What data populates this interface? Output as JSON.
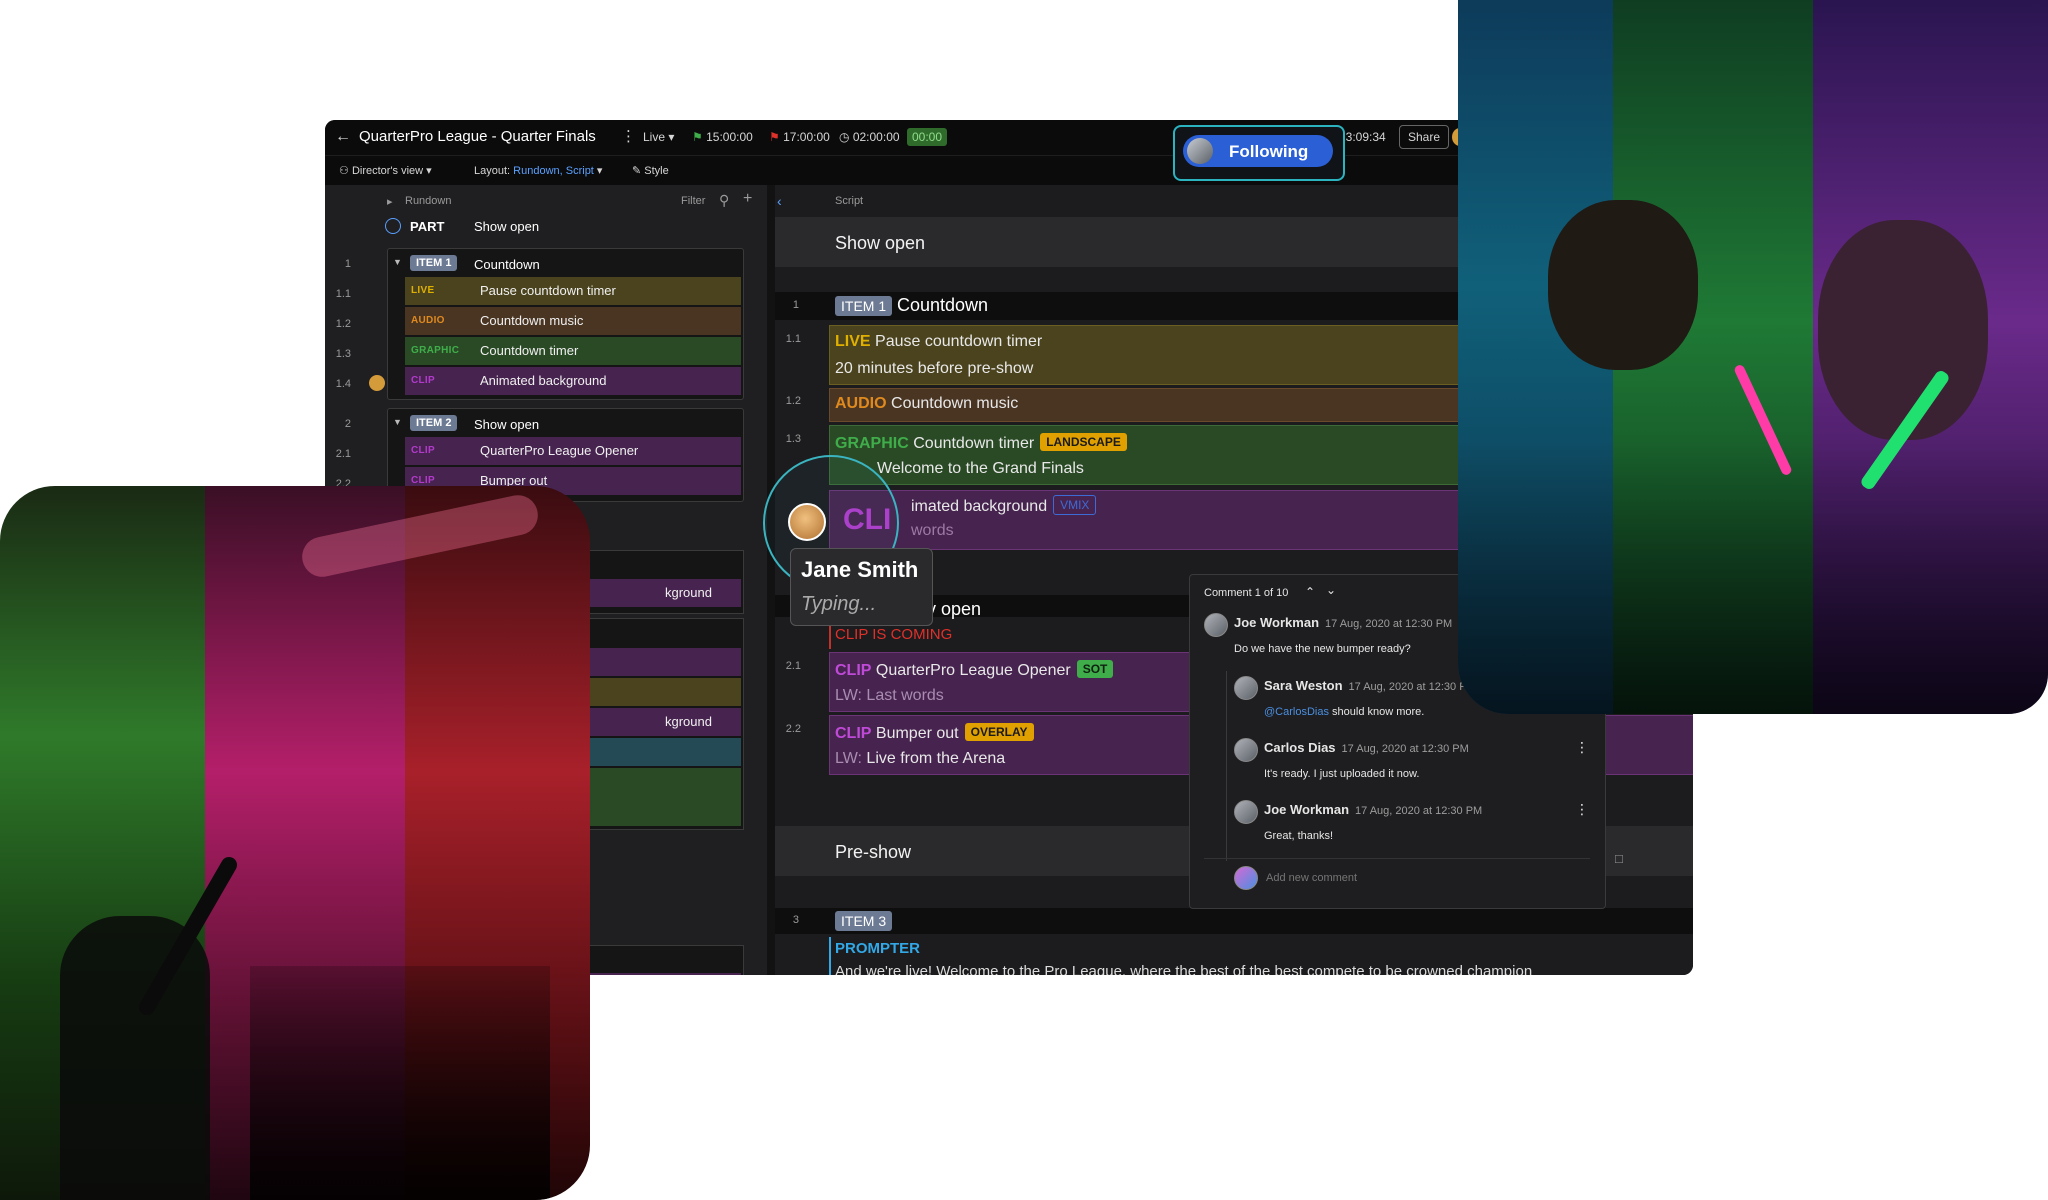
{
  "topbar": {
    "title": "QuarterPro League - Quarter Finals",
    "live_label": "Live",
    "start_time": "15:00:00",
    "end_time": "17:00:00",
    "duration": "02:00:00",
    "timer": "00:00",
    "clock": "13:09:34",
    "share_label": "Share",
    "following_label": "Following"
  },
  "toolbar": {
    "view_label": "Director's view",
    "layout_label": "Layout:",
    "layout_value": "Rundown, Script",
    "style_label": "Style"
  },
  "rundown": {
    "header": "Rundown",
    "filter_label": "Filter",
    "part_label": "PART",
    "part_title": "Show open",
    "items": [
      {
        "num": "1",
        "badge": "ITEM 1",
        "title": "Countdown"
      },
      {
        "num": "2",
        "badge": "ITEM 2",
        "title": "Show open"
      }
    ],
    "rows": [
      {
        "num": "1.1",
        "tag": "LIVE",
        "text": "Pause countdown timer"
      },
      {
        "num": "1.2",
        "tag": "AUDIO",
        "text": "Countdown music"
      },
      {
        "num": "1.3",
        "tag": "GRAPHIC",
        "text": "Countdown timer"
      },
      {
        "num": "1.4",
        "tag": "CLIP",
        "text": "Animated background"
      },
      {
        "num": "2.1",
        "tag": "CLIP",
        "text": "QuarterPro League Opener"
      },
      {
        "num": "2.2",
        "tag": "CLIP",
        "text": "Bumper out"
      }
    ],
    "partial_1": "kground",
    "partial_2": "kground",
    "partial_3": "on"
  },
  "script": {
    "header": "Script",
    "section_1": "Show open",
    "item_1": {
      "num": "1",
      "badge": "ITEM 1",
      "title": "Countdown"
    },
    "r11": {
      "num": "1.1",
      "tag": "LIVE",
      "text": "Pause countdown timer",
      "sub": "20 minutes before pre-show"
    },
    "r12": {
      "num": "1.2",
      "tag": "AUDIO",
      "text": "Countdown music"
    },
    "r13": {
      "num": "1.3",
      "tag": "GRAPHIC",
      "text": "Countdown timer",
      "pill": "LANDSCAPE",
      "sub": "Welcome to the Grand Finals"
    },
    "r14": {
      "tag_partial": "CLI",
      "text": "imated background",
      "pill": "VMIX",
      "sub": "words"
    },
    "section_2": "v open",
    "warning": "CLIP IS COMING",
    "r21": {
      "num": "2.1",
      "tag": "CLIP",
      "text": "QuarterPro League Opener",
      "pill": "SOT",
      "sub_label": "LW:",
      "sub": "Last words"
    },
    "r22": {
      "num": "2.2",
      "tag": "CLIP",
      "text": "Bumper out",
      "pill": "OVERLAY",
      "sub_label": "LW:",
      "sub": "Live from the Arena"
    },
    "section_3": "Pre-show",
    "item_3": {
      "num": "3",
      "badge": "ITEM 3"
    },
    "prompter": "PROMPTER",
    "prompter_text": "And we're live! Welcome to the Pro League, where the best of the best compete to be crowned champion"
  },
  "presence": {
    "name": "Jane Smith",
    "status": "Typing..."
  },
  "comments": {
    "counter": "Comment 1 of 10",
    "list": [
      {
        "name": "Joe Workman",
        "date": "17 Aug, 2020 at 12:30 PM",
        "text": "Do we have the new bumper ready?"
      },
      {
        "name": "Sara Weston",
        "date": "17 Aug, 2020 at 12:30 PM",
        "mention": "@CarlosDias",
        "text": "should know more."
      },
      {
        "name": "Carlos Dias",
        "date": "17 Aug, 2020 at 12:30 PM",
        "text": "It's ready. I just uploaded it now."
      },
      {
        "name": "Joe Workman",
        "date": "17 Aug, 2020 at 12:30 PM",
        "text": "Great, thanks!"
      }
    ],
    "placeholder": "Add new comment"
  },
  "colors": {
    "live": "#e0b000",
    "audio": "#e08a1e",
    "graphic": "#3fae4a",
    "clip": "#b23acb",
    "following_border": "#2bb3c0",
    "following_bg": "#2a5fd6",
    "prompter": "#32a8e6"
  }
}
